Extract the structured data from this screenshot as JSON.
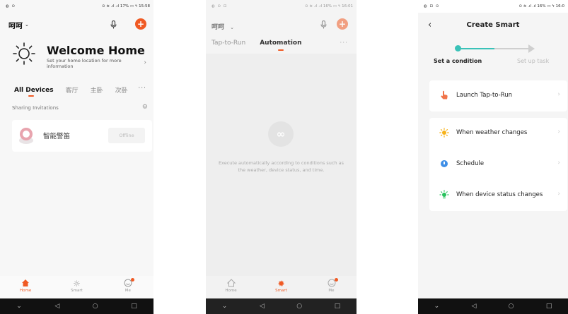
{
  "screen1": {
    "status_left": "◍ ⊙",
    "status_right": "⊙ ≋ .ıl .ıl 17% ▭ ϟ 15:58",
    "home_name": "呵呵",
    "welcome_title": "Welcome Home",
    "welcome_sub": "Set your home location for more information",
    "room_tabs": [
      "All Devices",
      "客厅",
      "主卧",
      "次卧"
    ],
    "more_tabs": "···",
    "sharing_label": "Sharing Invitations",
    "device_name": "智能警笛",
    "device_status": "Offline",
    "tabbar": [
      {
        "label": "Home",
        "icon": "home-icon"
      },
      {
        "label": "Smart",
        "icon": "sun-icon"
      },
      {
        "label": "Me",
        "icon": "profile-icon"
      }
    ]
  },
  "screen2": {
    "status_left": "◍ ⊙ ⊡",
    "status_right": "⊙ ≋ .ıl .ıl 16% ▭ ϟ 16:01",
    "home_name": "呵呵",
    "tabs": [
      "Tap-to-Run",
      "Automation"
    ],
    "more_tabs": "···",
    "empty_text": "Execute automatically according to conditions such as the weather, device status, and time.",
    "tabbar": [
      {
        "label": "Home",
        "icon": "home-icon"
      },
      {
        "label": "Smart",
        "icon": "sun-icon"
      },
      {
        "label": "Me",
        "icon": "profile-icon"
      }
    ]
  },
  "screen3": {
    "status_left": "◍ ⊡ ⊙",
    "status_right": "⊙ ≋ .ıl .ıl 16% ▭ ϟ 16:0",
    "title": "Create Smart",
    "step1": "Set a condition",
    "step2": "Set up task",
    "options": [
      {
        "label": "Launch Tap-to-Run",
        "icon": "tap-hand-icon"
      },
      {
        "label": "When weather changes",
        "icon": "weather-sun-icon"
      },
      {
        "label": "Schedule",
        "icon": "clock-icon"
      },
      {
        "label": "When device status changes",
        "icon": "device-status-icon"
      }
    ]
  },
  "colors": {
    "accent": "#f05a24",
    "teal": "#3ac2b8",
    "schedule_blue": "#3e8ee6",
    "device_green": "#28c25d",
    "weather_yellow": "#f6b21a"
  }
}
